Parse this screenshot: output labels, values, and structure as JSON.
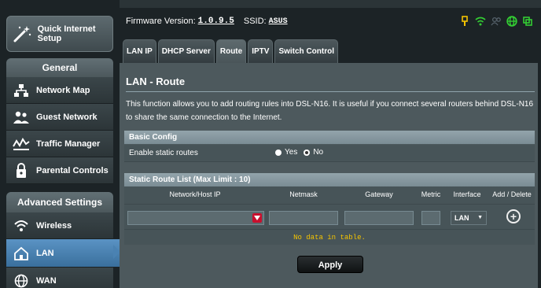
{
  "sidebar": {
    "quick_setup": "Quick Internet Setup",
    "general_heading": "General",
    "general_items": [
      {
        "label": "Network Map",
        "icon": "network-map-icon"
      },
      {
        "label": "Guest Network",
        "icon": "guest-network-icon"
      },
      {
        "label": "Traffic Manager",
        "icon": "traffic-manager-icon"
      },
      {
        "label": "Parental Controls",
        "icon": "parental-controls-icon"
      }
    ],
    "advanced_heading": "Advanced Settings",
    "advanced_items": [
      {
        "label": "Wireless",
        "icon": "wireless-icon"
      },
      {
        "label": "LAN",
        "icon": "lan-icon",
        "active": true
      },
      {
        "label": "WAN",
        "icon": "wan-icon"
      }
    ]
  },
  "header": {
    "firmware_label": "Firmware Version:",
    "firmware_value": "1.0.9.5",
    "ssid_label": "SSID:",
    "ssid_value": "ASUS",
    "status_icons": [
      "usb-icon",
      "wifi-icon",
      "users-icon",
      "internet-icon",
      "app-icon"
    ],
    "status_color": "#33cc33"
  },
  "tabs": [
    "LAN IP",
    "DHCP Server",
    "Route",
    "IPTV",
    "Switch Control"
  ],
  "active_tab": "Route",
  "main": {
    "title": "LAN - Route",
    "description": "This function allows you to add routing rules into DSL-N16. It is useful if you connect several routers behind DSL-N16 to share the same connection to the Internet.",
    "basic_config": {
      "heading": "Basic Config",
      "enable_label": "Enable static routes",
      "yes_label": "Yes",
      "no_label": "No",
      "selected": "No"
    },
    "route_list": {
      "heading": "Static Route List (Max Limit : 10)",
      "columns": [
        "Network/Host IP",
        "Netmask",
        "Gateway",
        "Metric",
        "Interface",
        "Add / Delete"
      ],
      "interface_value": "LAN",
      "empty_text": "No data in table."
    },
    "apply_label": "Apply"
  },
  "colors": {
    "accent_red": "#c8102e",
    "empty_text": "#f5c400",
    "active_nav": "#4a82b2"
  }
}
